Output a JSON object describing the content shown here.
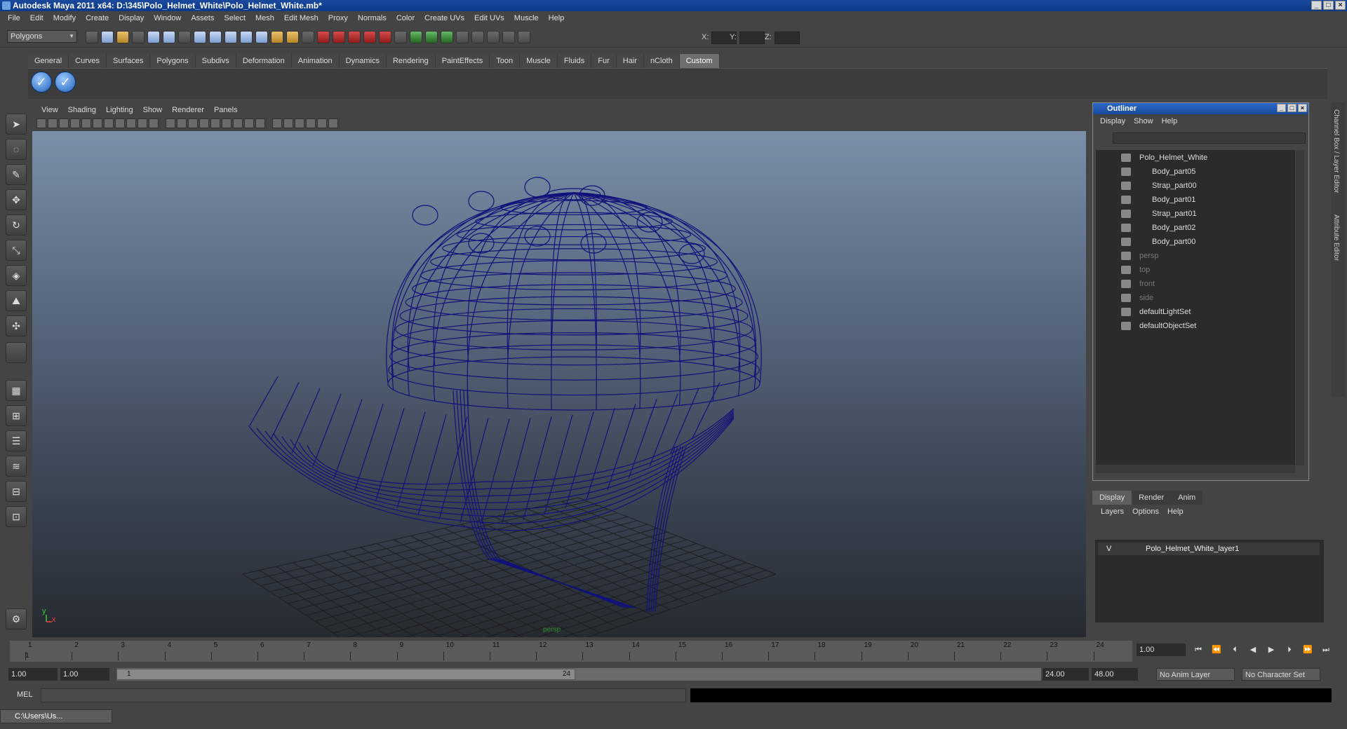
{
  "window": {
    "title": "Autodesk Maya 2011 x64: D:\\345\\Polo_Helmet_White\\Polo_Helmet_White.mb*"
  },
  "menubar": [
    "File",
    "Edit",
    "Modify",
    "Create",
    "Display",
    "Window",
    "Assets",
    "Select",
    "Mesh",
    "Edit Mesh",
    "Proxy",
    "Normals",
    "Color",
    "Create UVs",
    "Edit UVs",
    "Muscle",
    "Help"
  ],
  "toolbar": {
    "mode": "Polygons",
    "x_label": "X:",
    "y_label": "Y:",
    "z_label": "Z:"
  },
  "shelf_tabs": [
    "General",
    "Curves",
    "Surfaces",
    "Polygons",
    "Subdivs",
    "Deformation",
    "Animation",
    "Dynamics",
    "Rendering",
    "PaintEffects",
    "Toon",
    "Muscle",
    "Fluids",
    "Fur",
    "Hair",
    "nCloth",
    "Custom"
  ],
  "shelf_active": "Custom",
  "viewport_menu": [
    "View",
    "Shading",
    "Lighting",
    "Show",
    "Renderer",
    "Panels"
  ],
  "viewport": {
    "camera_label": "persp",
    "axis_y": "y",
    "axis_x": "x"
  },
  "outliner": {
    "title": "Outliner",
    "menu": [
      "Display",
      "Show",
      "Help"
    ],
    "items": [
      {
        "label": "Polo_Helmet_White",
        "indent": 0,
        "dim": false
      },
      {
        "label": "Body_part05",
        "indent": 1,
        "dim": false
      },
      {
        "label": "Strap_part00",
        "indent": 1,
        "dim": false
      },
      {
        "label": "Body_part01",
        "indent": 1,
        "dim": false
      },
      {
        "label": "Strap_part01",
        "indent": 1,
        "dim": false
      },
      {
        "label": "Body_part02",
        "indent": 1,
        "dim": false
      },
      {
        "label": "Body_part00",
        "indent": 1,
        "dim": false
      },
      {
        "label": "persp",
        "indent": 0,
        "dim": true
      },
      {
        "label": "top",
        "indent": 0,
        "dim": true
      },
      {
        "label": "front",
        "indent": 0,
        "dim": true
      },
      {
        "label": "side",
        "indent": 0,
        "dim": true
      },
      {
        "label": "defaultLightSet",
        "indent": 0,
        "dim": false
      },
      {
        "label": "defaultObjectSet",
        "indent": 0,
        "dim": false
      }
    ]
  },
  "side_tabs": [
    "Channel Box / Layer Editor",
    "Attribute Editor"
  ],
  "layer_editor": {
    "tabs": [
      "Display",
      "Render",
      "Anim"
    ],
    "menu": [
      "Layers",
      "Options",
      "Help"
    ],
    "layer_visible": "V",
    "layer_name": "Polo_Helmet_White_layer1"
  },
  "timeline": {
    "ticks": [
      "1",
      "2",
      "3",
      "4",
      "5",
      "6",
      "7",
      "8",
      "9",
      "10",
      "11",
      "12",
      "13",
      "14",
      "15",
      "16",
      "17",
      "18",
      "19",
      "20",
      "21",
      "22",
      "23",
      "24"
    ],
    "current_frame": "1",
    "current_frame_field": "1.00"
  },
  "range": {
    "start": "1.00",
    "playback_start": "1.00",
    "slider_start": "1",
    "slider_end": "24",
    "playback_end": "24.00",
    "end": "48.00",
    "anim_layer": "No Anim Layer",
    "character_set": "No Character Set"
  },
  "command_line": {
    "label": "MEL"
  },
  "taskbar": {
    "label": "C:\\Users\\Us..."
  }
}
